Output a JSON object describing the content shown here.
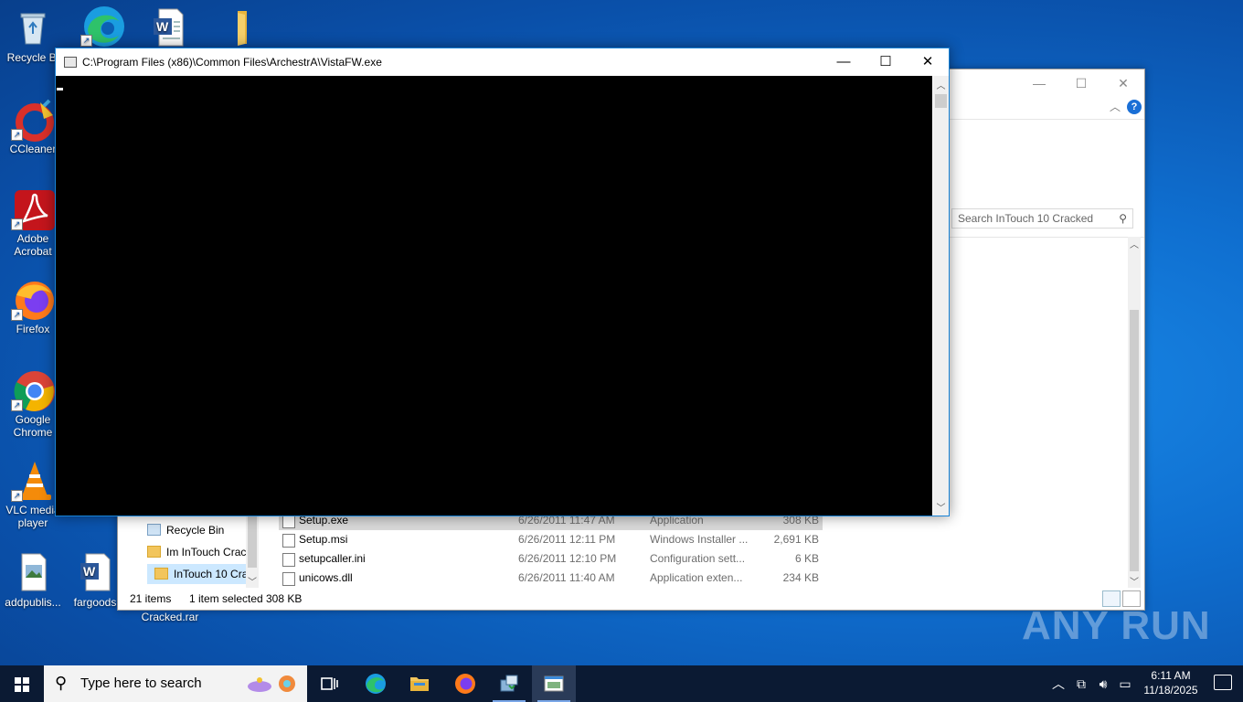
{
  "desktop": {
    "icons": [
      {
        "name": "recycle-bin",
        "label": "Recycle Bin",
        "visible_label": "Recycle Bi"
      },
      {
        "name": "edge",
        "label": ""
      },
      {
        "name": "word-doc",
        "label": ""
      },
      {
        "name": "folder",
        "label": ""
      },
      {
        "name": "ccleaner",
        "label": "CCleaner"
      },
      {
        "name": "adobe-acrobat",
        "label": "Adobe Acrobat"
      },
      {
        "name": "firefox",
        "label": "Firefox"
      },
      {
        "name": "google-chrome",
        "label": "Google Chrome"
      },
      {
        "name": "vlc",
        "label": "VLC media player"
      },
      {
        "name": "addpublish",
        "label": "addpublis..."
      },
      {
        "name": "fargoods",
        "label": "fargoods"
      }
    ],
    "partial_label_behind_console": "Cracked.rar"
  },
  "console": {
    "title": "C:\\Program Files (x86)\\Common Files\\ArchestrA\\VistaFW.exe",
    "minimize": "—",
    "maximize": "☐",
    "close": "✕"
  },
  "explorer": {
    "minimize": "—",
    "maximize": "☐",
    "close": "✕",
    "help": "?",
    "search_placeholder": "Search InTouch 10 Cracked",
    "nav_items": [
      {
        "label": "Recycle Bin",
        "selected": false
      },
      {
        "label": "Im InTouch Crac",
        "selected": false
      },
      {
        "label": "InTouch 10 Cra",
        "selected": true
      }
    ],
    "files": [
      {
        "name": "Setup.exe",
        "date": "6/26/2011 11:47 AM",
        "type": "Application",
        "size": "308 KB",
        "selected": true
      },
      {
        "name": "Setup.msi",
        "date": "6/26/2011 12:11 PM",
        "type": "Windows Installer ...",
        "size": "2,691 KB",
        "selected": false
      },
      {
        "name": "setupcaller.ini",
        "date": "6/26/2011 12:10 PM",
        "type": "Configuration sett...",
        "size": "6 KB",
        "selected": false
      },
      {
        "name": "unicows.dll",
        "date": "6/26/2011 11:40 AM",
        "type": "Application exten...",
        "size": "234 KB",
        "selected": false
      }
    ],
    "status": {
      "items": "21 items",
      "selected": "1 item selected",
      "size": "308 KB"
    }
  },
  "taskbar": {
    "search_placeholder": "Type here to search",
    "time": "6:11 AM",
    "date": "11/18/2025",
    "apps": [
      "task-view",
      "edge",
      "file-explorer",
      "firefox",
      "installer",
      "console"
    ]
  },
  "watermark": "ANY RUN",
  "colors": {
    "accent": "#1883d7",
    "taskbar": "#0b1a33",
    "desktop": "#0f6fd0",
    "selection": "#cce8ff"
  }
}
